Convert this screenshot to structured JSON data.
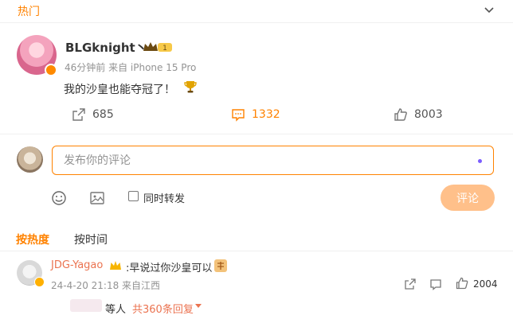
{
  "header": {
    "hot_tab": "热门"
  },
  "post": {
    "username": "BLGknight丶",
    "level_badge": "1",
    "meta": "46分钟前 来自 iPhone 15 Pro",
    "text": "我的沙皇也能夺冠了！",
    "actions": {
      "forward": "685",
      "comment": "1332",
      "like": "8003"
    }
  },
  "composer": {
    "placeholder": "发布你的评论",
    "repost_label": "同时转发",
    "submit_label": "评论"
  },
  "sort": {
    "hot": "按热度",
    "time": "按时间"
  },
  "comment": {
    "name": "JDG-Yagao",
    "text": ":早说过你沙皇可以",
    "meta": "24-4-20 21:18 来自江西",
    "like_count": "2004",
    "reply_others": "等人",
    "reply_count": "共360条回复"
  },
  "colors": {
    "accent": "#ff8200",
    "username_link": "#eb7350",
    "button_disabled": "#ffc08a"
  }
}
